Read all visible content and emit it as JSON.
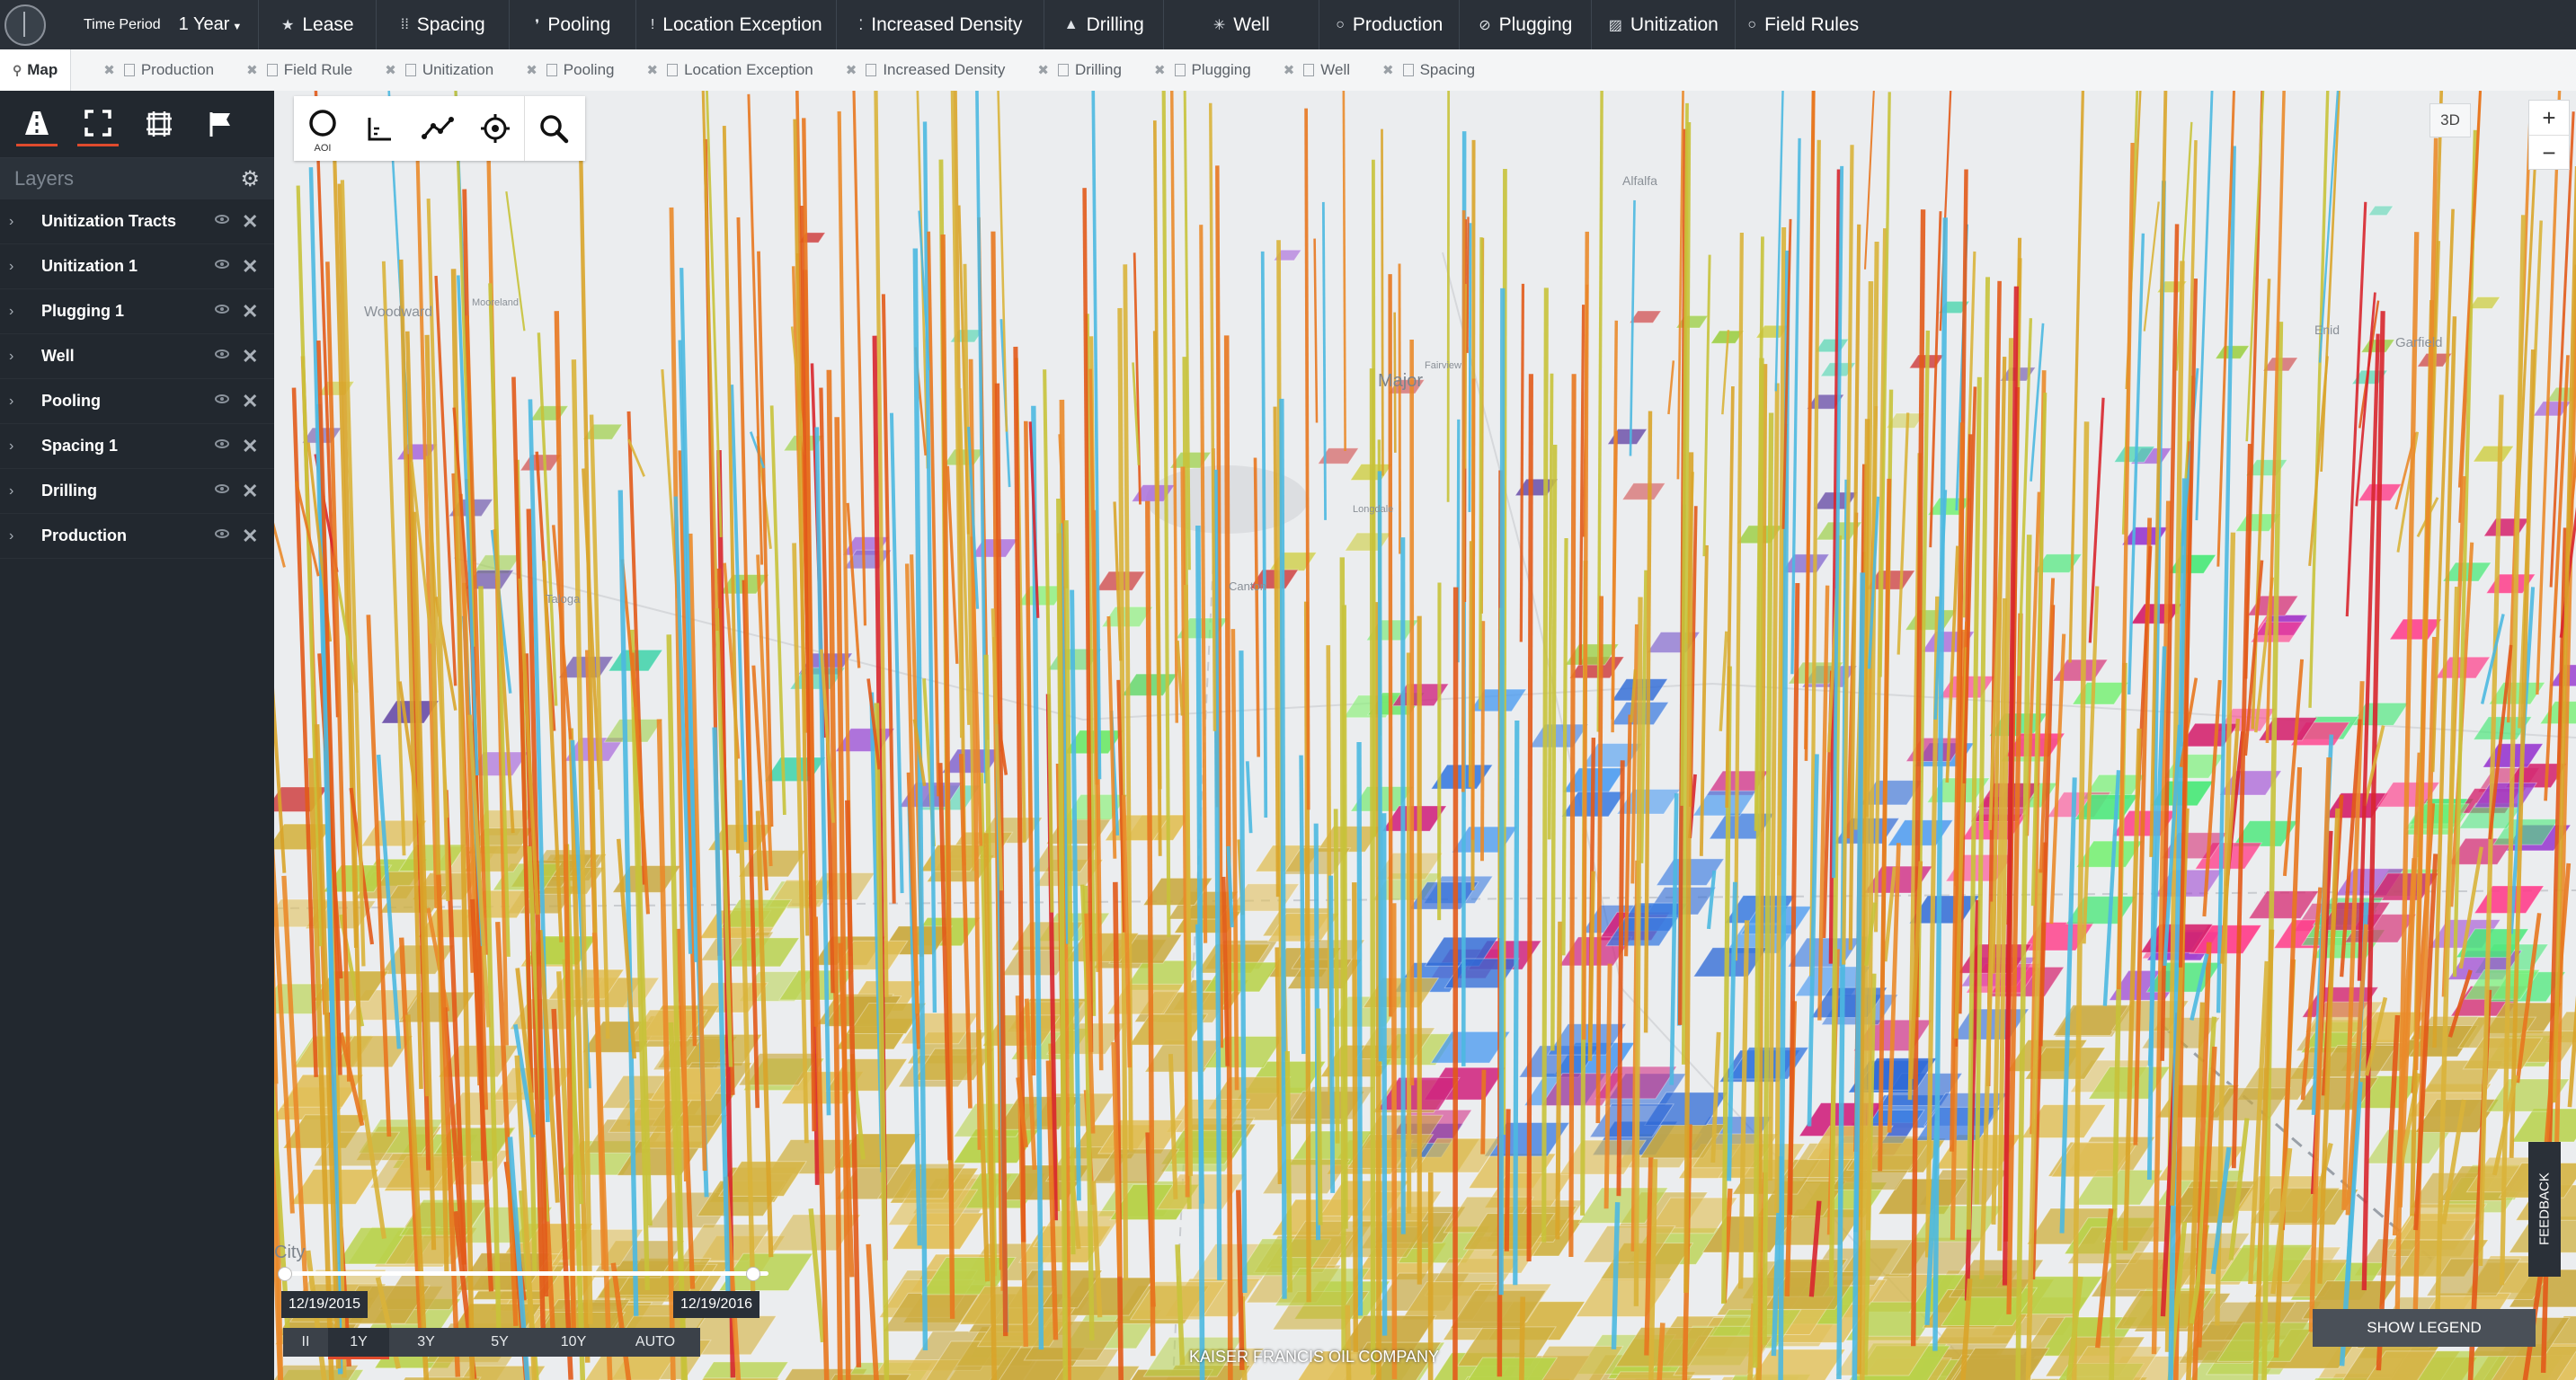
{
  "topbar": {
    "time_period_label": "Time Period",
    "time_period_value": "1 Year",
    "buttons": [
      {
        "label": "Lease",
        "icon": "star-icon"
      },
      {
        "label": "Spacing",
        "icon": "grid-dots-icon"
      },
      {
        "label": "Pooling",
        "icon": "drop-icon"
      },
      {
        "label": "Location Exception",
        "icon": "exclamation-icon"
      },
      {
        "label": "Increased Density",
        "icon": "density-icon"
      },
      {
        "label": "Drilling",
        "icon": "drill-icon"
      },
      {
        "label": "Well",
        "icon": "sun-icon"
      },
      {
        "label": "Production",
        "icon": "circle-icon"
      },
      {
        "label": "Plugging",
        "icon": "plug-icon"
      },
      {
        "label": "Unitization",
        "icon": "hatch-icon"
      },
      {
        "label": "Field Rules",
        "icon": "circle-icon"
      }
    ]
  },
  "tabs": {
    "active": "Map",
    "items": [
      "Production",
      "Field Rule",
      "Unitization",
      "Pooling",
      "Location Exception",
      "Increased Density",
      "Drilling",
      "Plugging",
      "Well",
      "Spacing"
    ]
  },
  "sidebar": {
    "layers_title": "Layers",
    "layers": [
      "Unitization Tracts",
      "Unitization 1",
      "Plugging 1",
      "Well",
      "Pooling",
      "Spacing 1",
      "Drilling",
      "Production"
    ]
  },
  "map": {
    "labels": {
      "woodward": "Woodward",
      "major": "Major",
      "canton": "Canton",
      "taloga": "Taloga",
      "enid": "Enid",
      "garfield": "Garfield",
      "city": "City",
      "fairview": "Fairview",
      "longdale": "Longdale",
      "alfalfa": "Alfalfa",
      "mooreland": "Mooreland"
    },
    "draw_tools": {
      "aoi_label": "AOI"
    },
    "view_mode": "3D",
    "zoom_in": "+",
    "zoom_out": "−",
    "feedback": "FEEDBACK",
    "show_legend": "SHOW LEGEND",
    "credit": "KAISER FRANCIS OIL COMPANY",
    "timeline": {
      "start_date": "12/19/2015",
      "end_date": "12/19/2016",
      "play_state": "II",
      "ranges": [
        "1Y",
        "3Y",
        "5Y",
        "10Y",
        "AUTO"
      ],
      "active_range": "1Y"
    }
  },
  "colors": {
    "topbar": "#2a3038",
    "sidebar": "#22282f",
    "accent": "#e04b2d",
    "map_bg": "#ebedef"
  }
}
